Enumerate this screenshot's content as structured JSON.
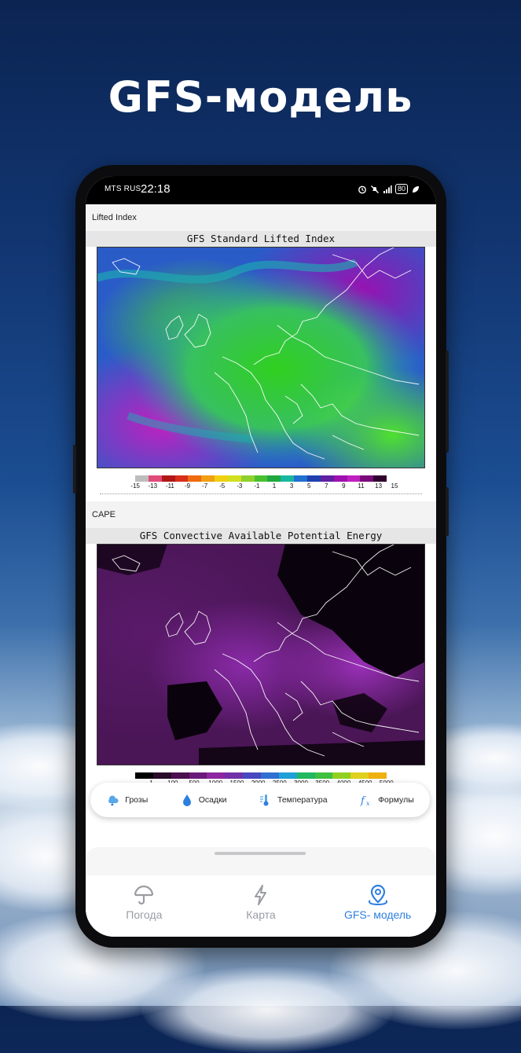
{
  "hero": {
    "title": "GFS-модель"
  },
  "statusbar": {
    "carrier": "MTS RUS",
    "time": "22:18",
    "battery": "80"
  },
  "sections": [
    {
      "label": "Lifted Index",
      "map_title": "GFS Standard Lifted Index",
      "scale_labels": [
        "-15",
        "-13",
        "-11",
        "-9",
        "-7",
        "-5",
        "-3",
        "-1",
        "1",
        "3",
        "5",
        "7",
        "9",
        "11",
        "13",
        "15"
      ],
      "scale_colors": [
        "#bdbdbd",
        "#e04b7a",
        "#b01818",
        "#d8301a",
        "#f06a10",
        "#f0a010",
        "#f0d010",
        "#d0e020",
        "#90d030",
        "#48c030",
        "#20a840",
        "#18b8a0",
        "#2070d0",
        "#2040b0",
        "#6020a0",
        "#a010b0",
        "#c020c0",
        "#7a0a7a",
        "#300030"
      ]
    },
    {
      "label": "CAPE",
      "map_title": "GFS Convective Available Potential Energy",
      "scale_labels": [
        "1",
        "100",
        "500",
        "1000",
        "1500",
        "2000",
        "2500",
        "3000",
        "3500",
        "4000",
        "4500",
        "5000"
      ],
      "scale_colors": [
        "#000000",
        "#2a0a2a",
        "#4a1050",
        "#6a1a78",
        "#8e25a0",
        "#7030a8",
        "#4848c0",
        "#3070d0",
        "#20a0d8",
        "#20b860",
        "#40c040",
        "#90d020",
        "#e0d020",
        "#f0b010"
      ]
    }
  ],
  "chips": [
    {
      "label": "Грозы",
      "icon": "storm-icon"
    },
    {
      "label": "Осадки",
      "icon": "drop-icon"
    },
    {
      "label": "Температура",
      "icon": "thermometer-icon"
    },
    {
      "label": "Формулы",
      "icon": "formula-icon"
    }
  ],
  "bottom_nav": [
    {
      "label": "Погода",
      "icon": "umbrella-icon",
      "active": false
    },
    {
      "label": "Карта",
      "icon": "lightning-icon",
      "active": false
    },
    {
      "label": "GFS- модель",
      "icon": "map-pin-icon",
      "active": true
    }
  ],
  "colors": {
    "accent": "#2f7fe0",
    "inactive": "#9a9ca3"
  }
}
